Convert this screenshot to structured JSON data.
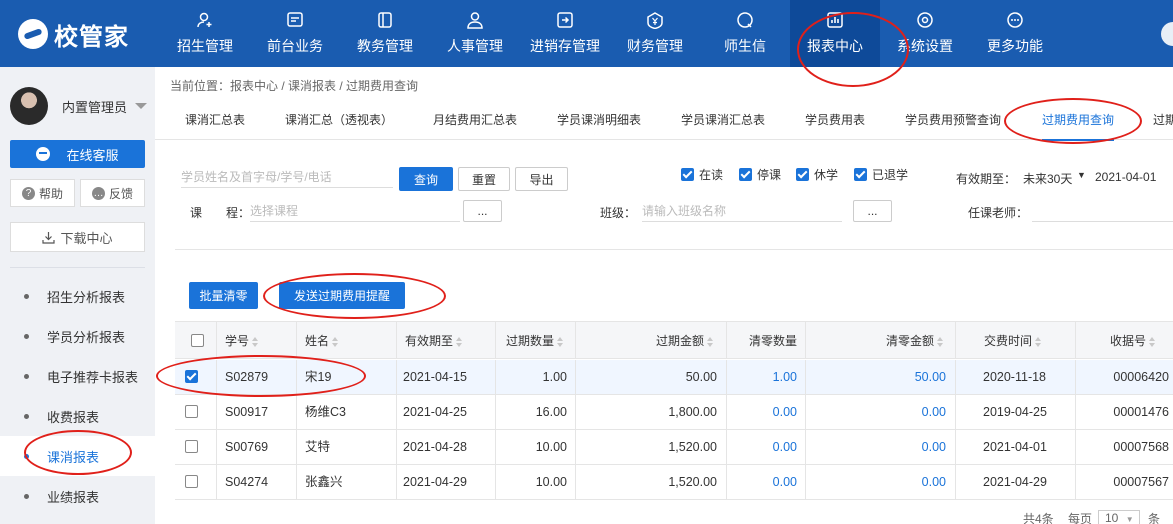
{
  "app": {
    "logo_text": "校管家"
  },
  "nav": [
    {
      "label": "招生管理",
      "icon": "add-user-icon"
    },
    {
      "label": "前台业务",
      "icon": "desk-icon"
    },
    {
      "label": "教务管理",
      "icon": "book-icon"
    },
    {
      "label": "人事管理",
      "icon": "person-icon"
    },
    {
      "label": "进销存管理",
      "icon": "inventory-icon"
    },
    {
      "label": "财务管理",
      "icon": "finance-icon"
    },
    {
      "label": "师生信",
      "icon": "chat-icon"
    },
    {
      "label": "报表中心",
      "icon": "report-icon",
      "active": true
    },
    {
      "label": "系统设置",
      "icon": "settings-icon"
    },
    {
      "label": "更多功能",
      "icon": "more-icon"
    }
  ],
  "sidebar": {
    "user_name": "内置管理员",
    "service_label": "在线客服",
    "help_label": "帮助",
    "feedback_label": "反馈",
    "download_label": "下载中心",
    "items": [
      {
        "label": "招生分析报表"
      },
      {
        "label": "学员分析报表"
      },
      {
        "label": "电子推荐卡报表"
      },
      {
        "label": "收费报表"
      },
      {
        "label": "课消报表",
        "active": true
      },
      {
        "label": "业绩报表"
      }
    ]
  },
  "breadcrumb": "当前位置：报表中心 / 课消报表 / 过期费用查询",
  "tabs": [
    {
      "label": "课消汇总表"
    },
    {
      "label": "课消汇总（透视表）"
    },
    {
      "label": "月结费用汇总表"
    },
    {
      "label": "学员课消明细表"
    },
    {
      "label": "学员课消汇总表"
    },
    {
      "label": "学员费用表"
    },
    {
      "label": "学员费用预警查询"
    },
    {
      "label": "过期费用查询",
      "active": true
    },
    {
      "label": "过期"
    }
  ],
  "filters": {
    "search_placeholder": "学员姓名及首字母/学号/电话",
    "query_label": "查询",
    "reset_label": "重置",
    "export_label": "导出",
    "status_checks": [
      {
        "label": "在读",
        "checked": true
      },
      {
        "label": "停课",
        "checked": true
      },
      {
        "label": "休学",
        "checked": true
      },
      {
        "label": "已退学",
        "checked": true
      }
    ],
    "expire_label": "有效期至：",
    "expire_option": "未来30天",
    "expire_date": "2021-04-01",
    "course_label": "课　　程：",
    "course_placeholder": "选择课程",
    "dots_label": "...",
    "class_label": "班级：",
    "class_placeholder": "请输入班级名称",
    "teacher_label": "任课老师："
  },
  "actions": {
    "batch_clear_label": "批量清零",
    "send_reminder_label": "发送过期费用提醒"
  },
  "table": {
    "headers": {
      "student_no": "学号",
      "name": "姓名",
      "valid_until": "有效期至",
      "expired_qty": "过期数量",
      "expired_amount": "过期金额",
      "cleared_qty": "清零数量",
      "cleared_amount": "清零金额",
      "paid_time": "交费时间",
      "receipt_no": "收据号"
    },
    "rows": [
      {
        "checked": true,
        "student_no": "S02879",
        "name": "宋19",
        "valid_until": "2021-04-15",
        "expired_qty": "1.00",
        "expired_amount": "50.00",
        "cleared_qty": "1.00",
        "cleared_amount": "50.00",
        "paid_time": "2020-11-18",
        "receipt_no": "00006420"
      },
      {
        "checked": false,
        "student_no": "S00917",
        "name": "杨维C3",
        "valid_until": "2021-04-25",
        "expired_qty": "16.00",
        "expired_amount": "1,800.00",
        "cleared_qty": "0.00",
        "cleared_amount": "0.00",
        "paid_time": "2019-04-25",
        "receipt_no": "00001476"
      },
      {
        "checked": false,
        "student_no": "S00769",
        "name": "艾特",
        "valid_until": "2021-04-28",
        "expired_qty": "10.00",
        "expired_amount": "1,520.00",
        "cleared_qty": "0.00",
        "cleared_amount": "0.00",
        "paid_time": "2021-04-01",
        "receipt_no": "00007568"
      },
      {
        "checked": false,
        "student_no": "S04274",
        "name": "张鑫兴",
        "valid_until": "2021-04-29",
        "expired_qty": "10.00",
        "expired_amount": "1,520.00",
        "cleared_qty": "0.00",
        "cleared_amount": "0.00",
        "paid_time": "2021-04-29",
        "receipt_no": "00007567"
      }
    ]
  },
  "pagination": {
    "total": "共4条",
    "per_page_label": "每页",
    "per_page_value": "10",
    "unit": "条"
  },
  "colors": {
    "primary": "#1a5cb0",
    "accent": "#1a73d9",
    "annotation": "#e0201a"
  }
}
